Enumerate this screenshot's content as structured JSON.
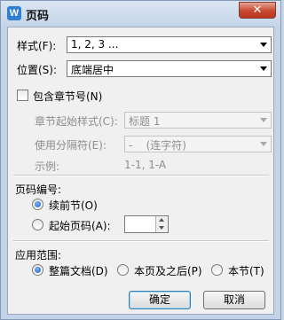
{
  "window": {
    "app_icon": "W",
    "title": "页码",
    "close_symbol": "✕",
    "icons": {
      "app": "wps-writer-icon",
      "close": "close-icon"
    }
  },
  "style": {
    "label": "样式(F):",
    "value": "1, 2, 3 ..."
  },
  "position": {
    "label": "位置(S):",
    "value": "底端居中"
  },
  "chapter": {
    "checkbox_label": "包含章节号(N)",
    "checked": false,
    "start_style_label": "章节起始样式(C):",
    "start_style_value": "标题 1",
    "separator_label": "使用分隔符(E):",
    "separator_value": "-    (连字符)",
    "example_label": "示例:",
    "example_value": "1-1, 1-A"
  },
  "numbering": {
    "section_title": "页码编号:",
    "continue_label": "续前节(O)",
    "start_at_label": "起始页码(A):",
    "selected": "continue",
    "start_at_value": ""
  },
  "scope": {
    "section_title": "应用范围:",
    "options": [
      "整篇文档(D)",
      "本页及之后(P)",
      "本节(T)"
    ],
    "selected": 0
  },
  "buttons": {
    "ok": "确定",
    "cancel": "取消"
  }
}
